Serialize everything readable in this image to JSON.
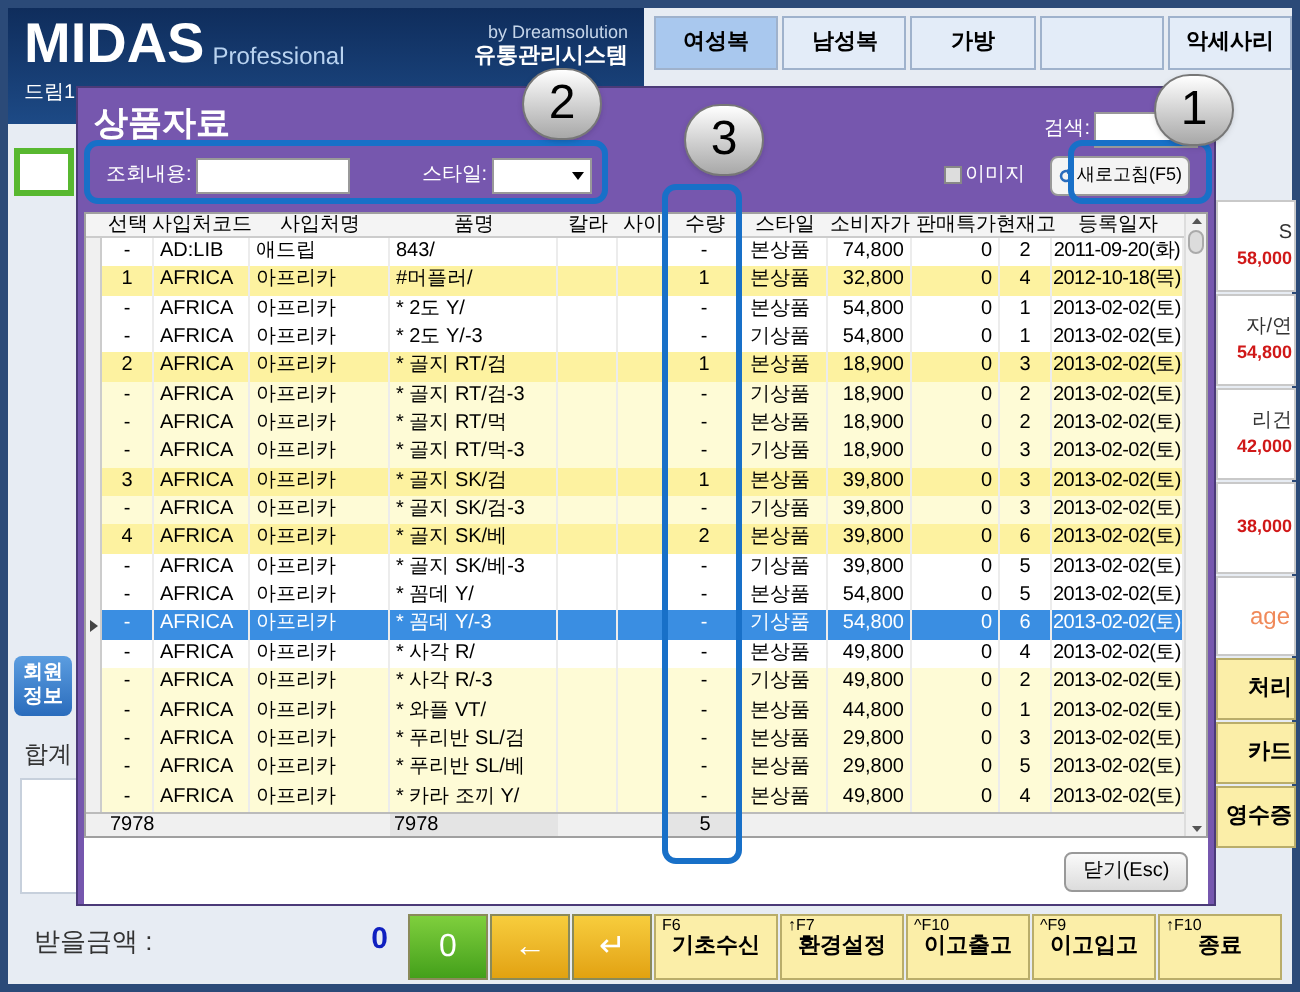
{
  "app": {
    "logo": "MIDAS",
    "logo_sub": "Professional",
    "vendor": "by Dreamsolution",
    "system_name": "유통관리시스템",
    "store_label": "드림1",
    "categories": [
      {
        "label": "여성복",
        "selected": true
      },
      {
        "label": "남성복",
        "selected": false
      },
      {
        "label": "가방",
        "selected": false
      },
      {
        "selected": false
      },
      {
        "label": "악세사리",
        "selected": false
      }
    ],
    "right_cards": [
      {
        "label": "S",
        "price": "58,000"
      },
      {
        "label": "자/연",
        "price": "54,800"
      },
      {
        "label": "리건",
        "price": "42,000"
      },
      {
        "price": "38,000"
      }
    ],
    "image_text": "age",
    "side_buttons": [
      "처리",
      "카드",
      "영수증"
    ],
    "member_button": "회원 정보",
    "total_label": "합계",
    "receive_label": "받을금액 :",
    "receive_value": "0",
    "keypad": [
      {
        "label": "0",
        "kind": "number"
      },
      {
        "label": "←",
        "kind": "arrow"
      },
      {
        "label": "↵",
        "kind": "arrow"
      }
    ],
    "function_keys": [
      {
        "key": "F6",
        "label": "기초수신"
      },
      {
        "key": "↑F7",
        "label": "환경설정"
      },
      {
        "key": "^F10",
        "label": "이고출고"
      },
      {
        "key": "^F9",
        "label": "이고입고"
      },
      {
        "key": "↑F10",
        "label": "종료"
      }
    ]
  },
  "dialog": {
    "title": "상품자료",
    "search_label": "검색:",
    "query_label": "조회내용:",
    "style_label": "스타일:",
    "image_checkbox": {
      "label": "이미지",
      "checked": false
    },
    "refresh_button": "새로고침(F5)",
    "columns": [
      "선택",
      "사입처코드",
      "사입처명",
      "품명",
      "칼라",
      "사이",
      "수량",
      "스타일",
      "소비자가",
      "판매특가",
      "현재고",
      "등록일자"
    ],
    "rows": [
      {
        "select": "-",
        "code": "AD:LIB",
        "vendor": "애드립",
        "item": "843/",
        "qty": "-",
        "style": "본상품",
        "price": "74,800",
        "special": "0",
        "stock": "2",
        "date": "2011-09-20(화)",
        "kind": "plain",
        "selected": false
      },
      {
        "select": "1",
        "code": "AFRICA",
        "vendor": "아프리카",
        "item": "#머플러/",
        "qty": "1",
        "style": "본상품",
        "price": "32,800",
        "special": "0",
        "stock": "4",
        "date": "2012-10-18(목)",
        "kind": "marked",
        "selected": false
      },
      {
        "select": "-",
        "code": "AFRICA",
        "vendor": "아프리카",
        "item": "* 2도 Y/",
        "qty": "-",
        "style": "본상품",
        "price": "54,800",
        "special": "0",
        "stock": "1",
        "date": "2013-02-02(토)",
        "kind": "plain",
        "selected": false
      },
      {
        "select": "-",
        "code": "AFRICA",
        "vendor": "아프리카",
        "item": "* 2도 Y/-3",
        "qty": "-",
        "style": "기상품",
        "price": "54,800",
        "special": "0",
        "stock": "1",
        "date": "2013-02-02(토)",
        "kind": "plain",
        "selected": false
      },
      {
        "select": "2",
        "code": "AFRICA",
        "vendor": "아프리카",
        "item": "* 골지 RT/검",
        "qty": "1",
        "style": "본상품",
        "price": "18,900",
        "special": "0",
        "stock": "3",
        "date": "2013-02-02(토)",
        "kind": "marked",
        "selected": false
      },
      {
        "select": "-",
        "code": "AFRICA",
        "vendor": "아프리카",
        "item": "* 골지 RT/검-3",
        "qty": "-",
        "style": "기상품",
        "price": "18,900",
        "special": "0",
        "stock": "2",
        "date": "2013-02-02(토)",
        "kind": "tinted",
        "selected": false
      },
      {
        "select": "-",
        "code": "AFRICA",
        "vendor": "아프리카",
        "item": "* 골지 RT/먹",
        "qty": "-",
        "style": "본상품",
        "price": "18,900",
        "special": "0",
        "stock": "2",
        "date": "2013-02-02(토)",
        "kind": "tinted",
        "selected": false
      },
      {
        "select": "-",
        "code": "AFRICA",
        "vendor": "아프리카",
        "item": "* 골지 RT/먹-3",
        "qty": "-",
        "style": "기상품",
        "price": "18,900",
        "special": "0",
        "stock": "3",
        "date": "2013-02-02(토)",
        "kind": "tinted",
        "selected": false
      },
      {
        "select": "3",
        "code": "AFRICA",
        "vendor": "아프리카",
        "item": "* 골지 SK/검",
        "qty": "1",
        "style": "본상품",
        "price": "39,800",
        "special": "0",
        "stock": "3",
        "date": "2013-02-02(토)",
        "kind": "marked",
        "selected": false
      },
      {
        "select": "-",
        "code": "AFRICA",
        "vendor": "아프리카",
        "item": "* 골지 SK/검-3",
        "qty": "-",
        "style": "기상품",
        "price": "39,800",
        "special": "0",
        "stock": "3",
        "date": "2013-02-02(토)",
        "kind": "tinted",
        "selected": false
      },
      {
        "select": "4",
        "code": "AFRICA",
        "vendor": "아프리카",
        "item": "* 골지 SK/베",
        "qty": "2",
        "style": "본상품",
        "price": "39,800",
        "special": "0",
        "stock": "6",
        "date": "2013-02-02(토)",
        "kind": "marked",
        "selected": false
      },
      {
        "select": "-",
        "code": "AFRICA",
        "vendor": "아프리카",
        "item": "* 골지 SK/베-3",
        "qty": "-",
        "style": "기상품",
        "price": "39,800",
        "special": "0",
        "stock": "5",
        "date": "2013-02-02(토)",
        "kind": "plain",
        "selected": false
      },
      {
        "select": "-",
        "code": "AFRICA",
        "vendor": "아프리카",
        "item": "* 꼼데 Y/",
        "qty": "-",
        "style": "본상품",
        "price": "54,800",
        "special": "0",
        "stock": "5",
        "date": "2013-02-02(토)",
        "kind": "plain",
        "selected": false
      },
      {
        "select": "-",
        "code": "AFRICA",
        "vendor": "아프리카",
        "item": "* 꼼데 Y/-3",
        "qty": "-",
        "style": "기상품",
        "price": "54,800",
        "special": "0",
        "stock": "6",
        "date": "2013-02-02(토)",
        "selected": true
      },
      {
        "select": "-",
        "code": "AFRICA",
        "vendor": "아프리카",
        "item": "* 사각 R/",
        "qty": "-",
        "style": "본상품",
        "price": "49,800",
        "special": "0",
        "stock": "4",
        "date": "2013-02-02(토)",
        "kind": "plain",
        "selected": false
      },
      {
        "select": "-",
        "code": "AFRICA",
        "vendor": "아프리카",
        "item": "* 사각 R/-3",
        "qty": "-",
        "style": "기상품",
        "price": "49,800",
        "special": "0",
        "stock": "2",
        "date": "2013-02-02(토)",
        "kind": "tinted",
        "selected": false
      },
      {
        "select": "-",
        "code": "AFRICA",
        "vendor": "아프리카",
        "item": "* 와플 VT/",
        "qty": "-",
        "style": "본상품",
        "price": "44,800",
        "special": "0",
        "stock": "1",
        "date": "2013-02-02(토)",
        "kind": "tinted",
        "selected": false
      },
      {
        "select": "-",
        "code": "AFRICA",
        "vendor": "아프리카",
        "item": "* 푸리반 SL/검",
        "qty": "-",
        "style": "본상품",
        "price": "29,800",
        "special": "0",
        "stock": "3",
        "date": "2013-02-02(토)",
        "kind": "tinted",
        "selected": false
      },
      {
        "select": "-",
        "code": "AFRICA",
        "vendor": "아프리카",
        "item": "* 푸리반 SL/베",
        "qty": "-",
        "style": "본상품",
        "price": "29,800",
        "special": "0",
        "stock": "5",
        "date": "2013-02-02(토)",
        "kind": "tinted",
        "selected": false
      },
      {
        "select": "-",
        "code": "AFRICA",
        "vendor": "아프리카",
        "item": "* 카라 조끼 Y/",
        "qty": "-",
        "style": "본상품",
        "price": "49,800",
        "special": "0",
        "stock": "4",
        "date": "2013-02-02(토)",
        "kind": "tinted",
        "selected": false
      }
    ],
    "totals": {
      "count": "7978",
      "item_count": "7978",
      "qty": "5"
    },
    "close_button": "닫기(Esc)"
  },
  "annotations": [
    {
      "number": "1"
    },
    {
      "number": "2"
    },
    {
      "number": "3"
    }
  ]
}
